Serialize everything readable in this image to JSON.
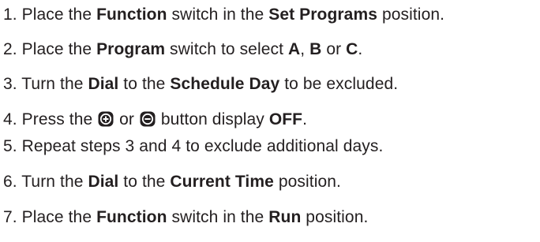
{
  "steps": [
    {
      "number": "1.",
      "parts": [
        "Place the ",
        "Function",
        " switch in the ",
        "Set Programs",
        " position."
      ]
    },
    {
      "number": "2.",
      "parts": [
        "Place the ",
        "Program",
        " switch to select ",
        "A",
        ", ",
        "B",
        " or ",
        "C",
        "."
      ]
    },
    {
      "number": "3.",
      "parts": [
        "Turn the ",
        "Dial",
        " to the ",
        "Schedule Day",
        " to be excluded."
      ]
    },
    {
      "number": "4.",
      "parts": [
        "Press the ",
        " or ",
        " button display ",
        "OFF",
        "."
      ],
      "icons": [
        "plus-button-icon",
        "minus-button-icon"
      ]
    },
    {
      "number": "5.",
      "parts": [
        "Repeat steps 3 and 4 to exclude additional days."
      ]
    },
    {
      "number": "6.",
      "parts": [
        "Turn the ",
        "Dial",
        " to the ",
        "Current Time",
        " position."
      ]
    },
    {
      "number": "7.",
      "parts": [
        "Place the ",
        "Function",
        " switch in the ",
        "Run",
        " position."
      ]
    }
  ],
  "colors": {
    "text": "#231f20",
    "icon_fill": "#231f20",
    "icon_glyph": "#ffffff"
  }
}
